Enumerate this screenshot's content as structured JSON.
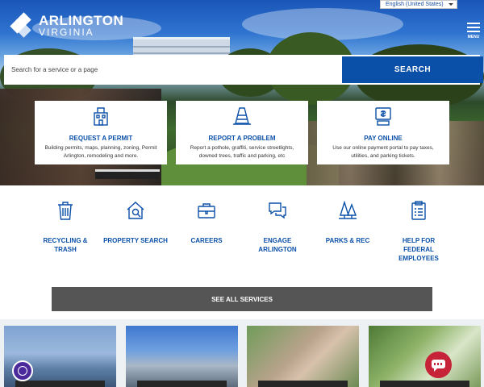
{
  "header": {
    "logo_name": "ARLINGTON",
    "logo_sub": "VIRGINIA",
    "language": "English (United States)",
    "menu_label": "MENU"
  },
  "search": {
    "placeholder": "Search for a service or a page",
    "button_label": "SEARCH"
  },
  "cards": [
    {
      "icon": "building-permit-icon",
      "title": "REQUEST A PERMIT",
      "desc": "Building permits, maps, planning, zoning, Permit Arlington, remodeling and more."
    },
    {
      "icon": "traffic-cone-icon",
      "title": "REPORT A PROBLEM",
      "desc": "Report a pothole, graffiti, service streetlights, downed trees, traffic and parking, etc"
    },
    {
      "icon": "payment-terminal-icon",
      "title": "PAY ONLINE",
      "desc": "Use our online payment portal to pay taxes, utilities, and parking tickets."
    }
  ],
  "services": [
    {
      "icon": "trash-can-icon",
      "label": "RECYCLING & TRASH"
    },
    {
      "icon": "house-search-icon",
      "label": "PROPERTY SEARCH"
    },
    {
      "icon": "briefcase-icon",
      "label": "CAREERS"
    },
    {
      "icon": "chat-bubbles-icon",
      "label": "ENGAGE ARLINGTON"
    },
    {
      "icon": "trees-icon",
      "label": "PARKS & REC"
    },
    {
      "icon": "clipboard-icon",
      "label": "HELP FOR FEDERAL EMPLOYEES"
    }
  ],
  "see_all_label": "SEE ALL SERVICES",
  "colors": {
    "brand_blue": "#0b50a8",
    "dark_button": "#555555",
    "chat_red": "#c62339",
    "accessibility_purple": "#4b2a9b"
  }
}
